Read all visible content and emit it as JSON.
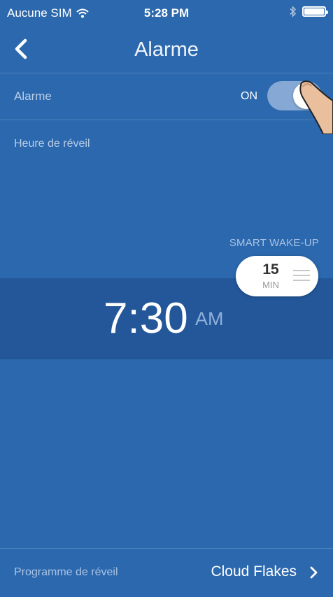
{
  "status_bar": {
    "carrier": "Aucune SIM",
    "time": "5:28 PM",
    "wifi_icon": "wifi-icon",
    "bluetooth_icon": "bluetooth-icon",
    "battery_icon": "battery-icon"
  },
  "nav": {
    "title": "Alarme",
    "back_icon": "chevron-left-icon"
  },
  "alarm": {
    "label": "Alarme",
    "state_label": "ON",
    "enabled": true
  },
  "wake": {
    "label": "Heure de réveil",
    "smart_label": "SMART WAKE-UP",
    "smart_value": "15",
    "smart_unit": "MIN",
    "time": "7:30",
    "ampm": "AM"
  },
  "program": {
    "label": "Programme de réveil",
    "value": "Cloud Flakes",
    "chevron_icon": "chevron-right-icon"
  },
  "colors": {
    "background": "#2c68ad",
    "time_band": "#23579a",
    "toggle_track": "#86a8d4"
  }
}
